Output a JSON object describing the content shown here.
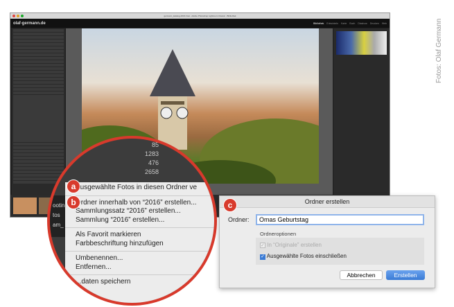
{
  "window": {
    "title": "germann_katalog-2016.lrcat - Adobe Photoshop Lightroom Classic - Bibliothek",
    "logo": "olaf-germann.de",
    "modules": [
      "Bibliothek",
      "Entwickeln",
      "Karte",
      "Buch",
      "Diashow",
      "Drucken",
      "Web"
    ],
    "active_module": "Bibliothek"
  },
  "zoom_circle": {
    "counts": [
      "85",
      "1283",
      "476",
      "2658"
    ],
    "filmstrip_fragments": [
      "ootin",
      "tos",
      "am_"
    ]
  },
  "context_menu": {
    "badge_a": "a",
    "badge_b": "b",
    "items": [
      [
        "Ausgewählte Fotos in diesen Ordner ve"
      ],
      [
        "Ordner innerhalb von “2016” erstellen...",
        "Sammlungssatz “2016” erstellen...",
        "Sammlung “2016” erstellen..."
      ],
      [
        "Als Favorit markieren",
        "Farbbeschriftung hinzufügen"
      ],
      [
        "Umbenennen...",
        "Entfernen..."
      ],
      [
        "...daten speichern"
      ]
    ]
  },
  "dialog": {
    "badge": "c",
    "title": "Ordner erstellen",
    "folder_label": "Ordner:",
    "folder_value": "Omas Geburtstag",
    "options_label": "Ordneroptionen",
    "option1": "In “Originale” erstellen",
    "option1_checked": true,
    "option1_disabled": true,
    "option2": "Ausgewählte Fotos einschließen",
    "option2_checked": true,
    "cancel": "Abbrechen",
    "create": "Erstellen",
    "accent": "#3a7bd5"
  },
  "credit": "Fotos: Olaf Germann",
  "colors": {
    "badge": "#d83a2c"
  }
}
